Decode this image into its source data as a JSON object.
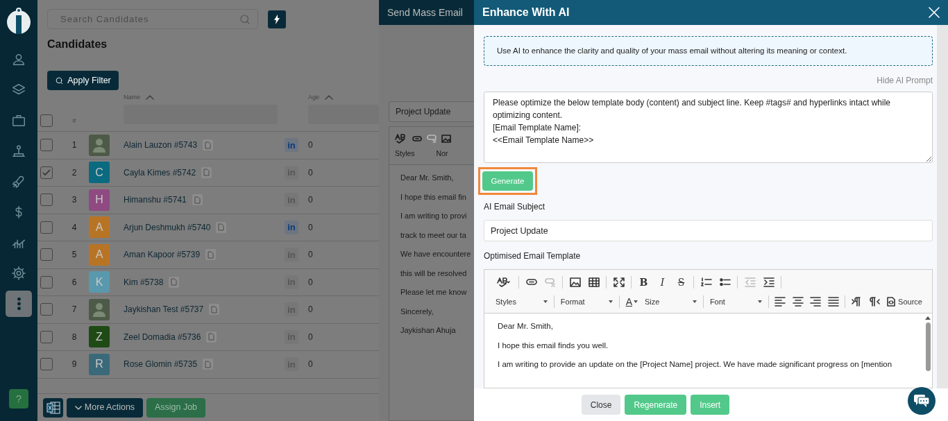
{
  "sidebar": {
    "items": [
      {
        "kind": "person",
        "selected": false
      },
      {
        "kind": "layers",
        "selected": false
      },
      {
        "kind": "briefcase",
        "selected": false
      },
      {
        "kind": "hierarchy",
        "selected": false
      },
      {
        "kind": "rocket",
        "selected": false
      },
      {
        "kind": "dollar",
        "selected": false
      },
      {
        "kind": "chart",
        "selected": false
      },
      {
        "kind": "gear",
        "selected": false
      },
      {
        "kind": "more",
        "selected": true
      }
    ],
    "help": "?"
  },
  "search": {
    "placeholder": "Search Candidates"
  },
  "page_title": "Candidates",
  "apply_filter": "Apply Filter",
  "table": {
    "select_all_checked": false,
    "columns": {
      "number": "#",
      "name": "Name",
      "age": "Age"
    },
    "rows": [
      {
        "checked": false,
        "number": "1",
        "avatar": {
          "kind": "photo"
        },
        "name": "Alain Lauzon #5743",
        "linkedin": {
          "label": "in",
          "active": true
        },
        "age": "0"
      },
      {
        "checked": true,
        "number": "2",
        "avatar": {
          "kind": "letter",
          "letter": "C",
          "color": "#0a6a80"
        },
        "name": "Cayla Kimes #5742",
        "linkedin": {
          "label": "in",
          "active": false
        },
        "age": "0"
      },
      {
        "checked": false,
        "number": "3",
        "avatar": {
          "kind": "letter",
          "letter": "H",
          "color": "#8f4a82"
        },
        "name": "Himanshu #5741",
        "linkedin": {
          "label": "in",
          "active": false
        },
        "age": "0"
      },
      {
        "checked": false,
        "number": "4",
        "avatar": {
          "kind": "letter",
          "letter": "A",
          "color": "#b87425"
        },
        "name": "Arjun Deshmukh #5740",
        "linkedin": {
          "label": "in",
          "active": true
        },
        "age": "0"
      },
      {
        "checked": false,
        "number": "5",
        "avatar": {
          "kind": "letter",
          "letter": "A",
          "color": "#b87425"
        },
        "name": "Aman Kapoor #5739",
        "linkedin": {
          "label": "in",
          "active": false
        },
        "age": "0"
      },
      {
        "checked": false,
        "number": "6",
        "avatar": {
          "kind": "letter",
          "letter": "K",
          "color": "#5a98ad"
        },
        "name": "Kim #5738",
        "linkedin": {
          "label": "in",
          "active": false
        },
        "age": "0"
      },
      {
        "checked": false,
        "number": "7",
        "avatar": {
          "kind": "photo"
        },
        "name": "Jaykishan Test #5737",
        "linkedin": {
          "label": "in",
          "active": false
        },
        "age": "0"
      },
      {
        "checked": false,
        "number": "8",
        "avatar": {
          "kind": "letter",
          "letter": "Z",
          "color": "#1f4a15"
        },
        "name": "Zeel Domadia #5736",
        "linkedin": {
          "label": "in",
          "active": false
        },
        "age": "0"
      },
      {
        "checked": false,
        "number": "9",
        "avatar": {
          "kind": "letter",
          "letter": "R",
          "color": "#3a6a7a"
        },
        "name": "Rose Glomin #5735",
        "linkedin": {
          "label": "in",
          "active": false
        },
        "age": "0"
      }
    ]
  },
  "bottom_bar": {
    "more_actions": "More Actions",
    "assign_job": "Assign Job"
  },
  "mass_email": {
    "title": "Send Mass Email",
    "subject": "Project Update",
    "toolbar": [
      "Styles",
      "Nor"
    ],
    "body_lines": [
      "Dear Mr. Smith,",
      "I hope this email fin",
      "I am writing to provi",
      "track to meet our ta",
      "We have encountere",
      "this will be resolved",
      "Please let me know",
      "Sincerely,",
      "Jaykishan Ahuja"
    ]
  },
  "enhance": {
    "title": "Enhance With AI",
    "note": "Use AI to enhance the clarity and quality of your mass email without altering its meaning or context.",
    "hide_prompt": "Hide AI Prompt",
    "prompt": "Please optimize the below template body (content) and subject line. Keep #tags# and hyperlinks intact while optimizing content.\n[Email Template Name]:\n<<Email Template Name>>",
    "generate": "Generate",
    "subject_label": "AI Email Subject",
    "subject": "Project Update",
    "template_label": "Optimised Email Template",
    "toolbar_row1": [
      {
        "kind": "spellcheck",
        "disabled": false
      },
      {
        "kind": "sep"
      },
      {
        "kind": "link",
        "disabled": false
      },
      {
        "kind": "unlink",
        "disabled": true
      },
      {
        "kind": "sep"
      },
      {
        "kind": "image",
        "disabled": false
      },
      {
        "kind": "table",
        "disabled": false
      },
      {
        "kind": "sep"
      },
      {
        "kind": "maximize",
        "disabled": false
      },
      {
        "kind": "sep"
      },
      {
        "kind": "bold",
        "label": "B"
      },
      {
        "kind": "italic",
        "label": "I"
      },
      {
        "kind": "strike",
        "label": "S"
      },
      {
        "kind": "sep"
      },
      {
        "kind": "ol",
        "disabled": false
      },
      {
        "kind": "ul",
        "disabled": false
      },
      {
        "kind": "sep"
      },
      {
        "kind": "outdent",
        "disabled": true
      },
      {
        "kind": "indent",
        "disabled": false
      },
      {
        "kind": "sep"
      }
    ],
    "toolbar_row2": [
      {
        "kind": "styles",
        "label": "Styles"
      },
      {
        "kind": "sep"
      },
      {
        "kind": "format",
        "label": "Format"
      },
      {
        "kind": "sep"
      },
      {
        "kind": "color",
        "label": "A"
      },
      {
        "kind": "size",
        "label": "Size"
      },
      {
        "kind": "sep"
      },
      {
        "kind": "font",
        "label": "Font"
      },
      {
        "kind": "sep"
      },
      {
        "kind": "align-left"
      },
      {
        "kind": "align-center"
      },
      {
        "kind": "align-right"
      },
      {
        "kind": "align-justify"
      },
      {
        "kind": "sep"
      },
      {
        "kind": "ltr"
      },
      {
        "kind": "rtl"
      },
      {
        "kind": "source",
        "label": "Source"
      }
    ],
    "body_lines": [
      "Dear Mr. Smith,",
      "I hope this email finds you well.",
      "I am writing to provide an update on the [Project Name] project. We have made significant progress on [mention"
    ],
    "buttons": [
      {
        "kind": "close",
        "label": "Close"
      },
      {
        "kind": "regenerate",
        "label": "Regenerate"
      },
      {
        "kind": "insert",
        "label": "Insert"
      }
    ]
  }
}
